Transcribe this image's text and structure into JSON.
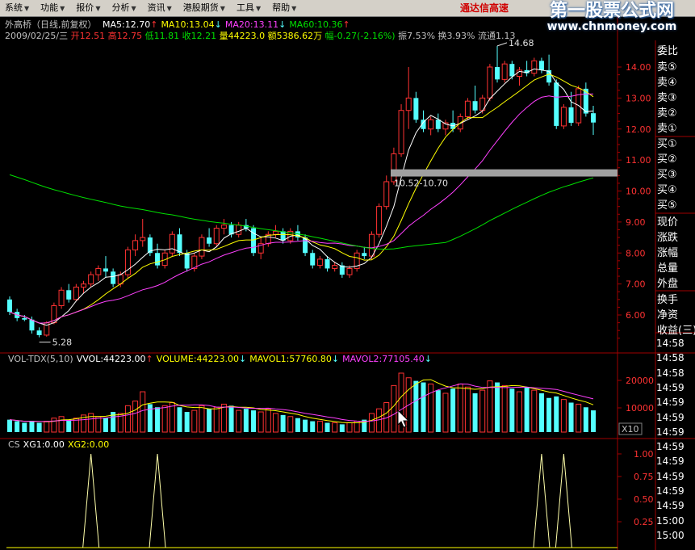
{
  "menu": [
    {
      "label": "系统"
    },
    {
      "label": "功能"
    },
    {
      "label": "报价"
    },
    {
      "label": "分析"
    },
    {
      "label": "资讯"
    },
    {
      "label": "港股期货"
    },
    {
      "label": "工具"
    },
    {
      "label": "帮助"
    }
  ],
  "app_title": "通达信高速",
  "watermark": {
    "cn": "第一股票公式网",
    "url": "www.chnmoney.com"
  },
  "price_panel": {
    "title": "外高桥（日线,前复权）",
    "ma_labels": [
      {
        "text": "MA5:12.70",
        "arrow": "↑",
        "color": "#ffffff"
      },
      {
        "text": "MA10:13.04",
        "arrow": "↓",
        "color": "#ffff00"
      },
      {
        "text": "MA20:13.11",
        "arrow": "↓",
        "color": "#ff40ff"
      },
      {
        "text": "MA60:10.36",
        "arrow": "↑",
        "color": "#00e000"
      }
    ],
    "info": {
      "date": "2009/02/25/三",
      "open": "开12.51",
      "high": "高12.75",
      "low": "低11.81",
      "close": "收12.21",
      "volume": "量44223.0",
      "amount": "额5386.62万",
      "change": "幅-0.27(-2.16%)",
      "amplitude": "振7.53%",
      "turnover": "换3.93%",
      "float": "流通1.13"
    },
    "annotations": {
      "high_label": "14.68",
      "low_label": "5.28",
      "range_label": "10.52-10.70"
    },
    "y_axis": [
      "14.00",
      "13.00",
      "12.00",
      "11.00",
      "10.00",
      "9.00",
      "8.00",
      "7.00",
      "6.00"
    ]
  },
  "volume_panel": {
    "labels": [
      {
        "text": "VOL-TDX(5,10)",
        "color": "#c0c0c0"
      },
      {
        "text": "VVOL:44223.00",
        "arrow": "↑",
        "color": "#ffffff"
      },
      {
        "text": "VOLUME:44223.00",
        "arrow": "↓",
        "color": "#ffff00"
      },
      {
        "text": "MAVOL1:57760.80",
        "arrow": "↓",
        "color": "#ffff00"
      },
      {
        "text": "MAVOL2:77105.40",
        "arrow": "↓",
        "color": "#ff40ff"
      }
    ],
    "y_axis": [
      "20000",
      "10000"
    ],
    "unit": "X10"
  },
  "cs_panel": {
    "labels": [
      {
        "text": "CS",
        "color": "#c0c0c0"
      },
      {
        "text": "XG1:0.00",
        "color": "#ffffff"
      },
      {
        "text": "XG2:0.00",
        "color": "#ffff00"
      }
    ],
    "y_axis": [
      "1.00",
      "0.75",
      "0.50",
      "0.25"
    ]
  },
  "order_book": {
    "top_partial": "委比",
    "sells": [
      "卖⑤",
      "卖④",
      "卖③",
      "卖②",
      "卖①"
    ],
    "buys": [
      "买①",
      "买②",
      "买③",
      "买④",
      "买⑤"
    ],
    "quote_labels": [
      "现价",
      "涨跌",
      "涨幅",
      "总量",
      "外盘"
    ],
    "stat_labels": [
      "换手",
      "净资",
      "收益(三)"
    ]
  },
  "tick_times": [
    "14:58",
    "14:58",
    "14:58",
    "14:59",
    "14:59",
    "14:59",
    "14:59",
    "14:59",
    "14:59",
    "14:59",
    "14:59",
    "14:59",
    "15:00",
    "15:00"
  ],
  "colors": {
    "up": "#ff3232",
    "down": "#54ffff",
    "ma5": "#ffffff",
    "ma10": "#ffff00",
    "ma20": "#ff40ff",
    "ma60": "#00e000",
    "frame": "#a00000"
  },
  "chart_data": {
    "type": "candlestick",
    "candles": [
      [
        6.5,
        6.6,
        6.0,
        6.1
      ],
      [
        6.1,
        6.2,
        5.8,
        5.9
      ],
      [
        5.9,
        6.0,
        5.8,
        5.85
      ],
      [
        5.85,
        5.95,
        5.4,
        5.5
      ],
      [
        5.5,
        5.6,
        5.28,
        5.35
      ],
      [
        5.35,
        5.8,
        5.3,
        5.75
      ],
      [
        5.75,
        6.4,
        5.7,
        6.3
      ],
      [
        6.3,
        6.9,
        6.2,
        6.8
      ],
      [
        6.8,
        7.0,
        6.4,
        6.5
      ],
      [
        6.5,
        7.0,
        6.45,
        6.9
      ],
      [
        6.9,
        7.1,
        6.7,
        7.0
      ],
      [
        7.0,
        7.4,
        6.9,
        7.3
      ],
      [
        7.3,
        7.6,
        7.1,
        7.5
      ],
      [
        7.5,
        7.9,
        7.2,
        7.4
      ],
      [
        7.4,
        7.5,
        6.9,
        7.0
      ],
      [
        7.0,
        7.4,
        6.9,
        7.3
      ],
      [
        7.3,
        8.2,
        7.2,
        8.1
      ],
      [
        8.1,
        8.6,
        7.9,
        8.4
      ],
      [
        8.4,
        9.1,
        8.2,
        8.5
      ],
      [
        8.5,
        8.6,
        7.9,
        8.0
      ],
      [
        8.0,
        8.3,
        7.5,
        7.6
      ],
      [
        7.6,
        8.1,
        7.5,
        8.0
      ],
      [
        8.0,
        8.7,
        7.9,
        8.6
      ],
      [
        8.6,
        8.8,
        7.9,
        8.0
      ],
      [
        8.0,
        8.1,
        7.4,
        7.5
      ],
      [
        7.5,
        8.0,
        7.4,
        7.9
      ],
      [
        7.9,
        8.6,
        7.8,
        8.5
      ],
      [
        8.5,
        8.8,
        8.2,
        8.3
      ],
      [
        8.3,
        8.9,
        8.2,
        8.8
      ],
      [
        8.8,
        9.1,
        8.6,
        8.9
      ],
      [
        8.9,
        9.0,
        8.5,
        8.6
      ],
      [
        8.6,
        9.0,
        8.5,
        8.9
      ],
      [
        8.9,
        9.1,
        8.7,
        8.8
      ],
      [
        8.8,
        8.9,
        7.9,
        8.0
      ],
      [
        8.0,
        8.5,
        7.8,
        8.3
      ],
      [
        8.3,
        8.7,
        8.2,
        8.6
      ],
      [
        8.6,
        8.9,
        8.5,
        8.7
      ],
      [
        8.7,
        8.8,
        8.3,
        8.4
      ],
      [
        8.4,
        8.8,
        8.3,
        8.7
      ],
      [
        8.7,
        8.9,
        8.4,
        8.5
      ],
      [
        8.5,
        8.6,
        7.9,
        8.0
      ],
      [
        8.0,
        8.1,
        7.5,
        7.6
      ],
      [
        7.6,
        7.9,
        7.5,
        7.8
      ],
      [
        7.8,
        7.9,
        7.4,
        7.5
      ],
      [
        7.5,
        7.7,
        7.4,
        7.6
      ],
      [
        7.6,
        7.7,
        7.2,
        7.3
      ],
      [
        7.3,
        7.6,
        7.2,
        7.5
      ],
      [
        7.5,
        8.1,
        7.4,
        8.0
      ],
      [
        8.0,
        8.2,
        7.8,
        7.9
      ],
      [
        7.9,
        8.7,
        7.8,
        8.6
      ],
      [
        8.6,
        9.6,
        8.5,
        9.5
      ],
      [
        9.5,
        10.5,
        9.4,
        10.3
      ],
      [
        10.3,
        11.4,
        10.2,
        11.2
      ],
      [
        11.2,
        12.8,
        11.1,
        12.6
      ],
      [
        12.6,
        14.0,
        12.0,
        13.0
      ],
      [
        13.0,
        13.2,
        12.2,
        12.3
      ],
      [
        12.3,
        12.6,
        11.9,
        12.0
      ],
      [
        12.0,
        12.4,
        11.8,
        12.3
      ],
      [
        12.3,
        12.5,
        11.9,
        12.0
      ],
      [
        12.0,
        12.3,
        11.8,
        12.2
      ],
      [
        12.2,
        12.6,
        11.9,
        12.0
      ],
      [
        12.0,
        12.5,
        11.9,
        12.4
      ],
      [
        12.4,
        13.0,
        12.3,
        12.9
      ],
      [
        12.9,
        13.4,
        12.5,
        12.6
      ],
      [
        12.6,
        13.1,
        12.5,
        13.0
      ],
      [
        13.0,
        14.1,
        12.9,
        14.0
      ],
      [
        14.0,
        14.68,
        13.5,
        13.6
      ],
      [
        13.6,
        14.2,
        13.5,
        14.1
      ],
      [
        14.1,
        14.2,
        13.6,
        13.7
      ],
      [
        13.7,
        14.0,
        13.4,
        13.9
      ],
      [
        13.9,
        14.2,
        13.7,
        13.8
      ],
      [
        13.8,
        14.3,
        13.7,
        14.2
      ],
      [
        14.2,
        14.3,
        13.8,
        13.9
      ],
      [
        13.9,
        14.4,
        13.4,
        13.5
      ],
      [
        13.5,
        13.6,
        12.0,
        12.1
      ],
      [
        12.1,
        12.8,
        12.0,
        12.7
      ],
      [
        12.7,
        13.2,
        12.1,
        12.2
      ],
      [
        12.2,
        13.4,
        12.1,
        13.3
      ],
      [
        13.3,
        13.5,
        12.4,
        12.5
      ],
      [
        12.51,
        12.75,
        11.81,
        12.21
      ]
    ],
    "volume": [
      8,
      7,
      6,
      7,
      6,
      7,
      9,
      10,
      8,
      9,
      11,
      12,
      10,
      9,
      13,
      12,
      17,
      20,
      26,
      18,
      16,
      17,
      19,
      16,
      13,
      14,
      17,
      15,
      16,
      18,
      17,
      14,
      15,
      14,
      13,
      15,
      12,
      11,
      10,
      9,
      8,
      7,
      7,
      6,
      6,
      5,
      6,
      7,
      8,
      12,
      15,
      19,
      30,
      38,
      35,
      33,
      32,
      31,
      27,
      25,
      28,
      31,
      29,
      25,
      27,
      33,
      32,
      30,
      28,
      26,
      29,
      27,
      25,
      22,
      23,
      21,
      19,
      18,
      16,
      14
    ],
    "signals_xg2": [
      11,
      20,
      72,
      75
    ]
  }
}
